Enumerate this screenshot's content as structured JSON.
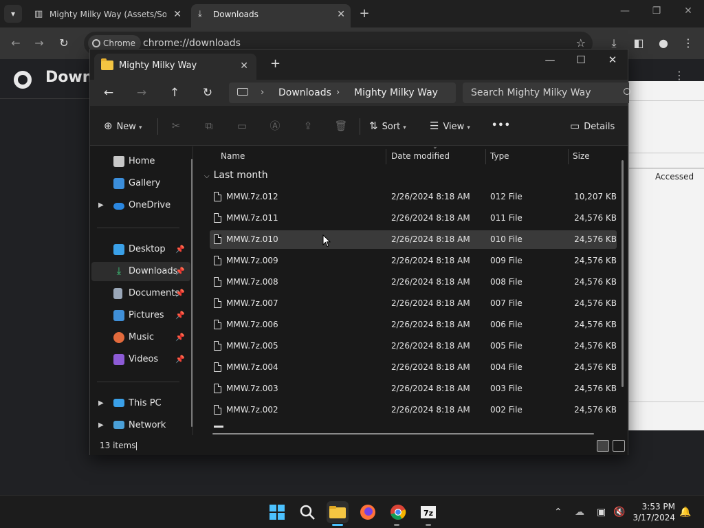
{
  "chrome": {
    "tabs": [
      {
        "title": "Mighty Milky Way (Assets/Soun",
        "icon": "archive-icon"
      },
      {
        "title": "Downloads",
        "icon": "download-icon"
      }
    ],
    "omnibox_chip": "Chrome",
    "url": "chrome://downloads",
    "page_title": "Downlo"
  },
  "sevenzip": {
    "column": "Accessed"
  },
  "explorer": {
    "tab_title": "Mighty Milky Way",
    "breadcrumbs": [
      "Downloads",
      "Mighty Milky Way"
    ],
    "search_placeholder": "Search Mighty Milky Way",
    "toolbar": {
      "new": "New",
      "sort": "Sort",
      "view": "View",
      "more": "•••",
      "details": "Details"
    },
    "sidebar": {
      "home": "Home",
      "gallery": "Gallery",
      "onedrive": "OneDrive",
      "desktop": "Desktop",
      "downloads": "Downloads",
      "documents": "Documents",
      "pictures": "Pictures",
      "music": "Music",
      "videos": "Videos",
      "thispc": "This PC",
      "network": "Network"
    },
    "columns": {
      "name": "Name",
      "date": "Date modified",
      "type": "Type",
      "size": "Size"
    },
    "group": "Last month",
    "files": [
      {
        "name": "MMW.7z.012",
        "date": "2/26/2024 8:18 AM",
        "type": "012 File",
        "size": "10,207 KB"
      },
      {
        "name": "MMW.7z.011",
        "date": "2/26/2024 8:18 AM",
        "type": "011 File",
        "size": "24,576 KB"
      },
      {
        "name": "MMW.7z.010",
        "date": "2/26/2024 8:18 AM",
        "type": "010 File",
        "size": "24,576 KB"
      },
      {
        "name": "MMW.7z.009",
        "date": "2/26/2024 8:18 AM",
        "type": "009 File",
        "size": "24,576 KB"
      },
      {
        "name": "MMW.7z.008",
        "date": "2/26/2024 8:18 AM",
        "type": "008 File",
        "size": "24,576 KB"
      },
      {
        "name": "MMW.7z.007",
        "date": "2/26/2024 8:18 AM",
        "type": "007 File",
        "size": "24,576 KB"
      },
      {
        "name": "MMW.7z.006",
        "date": "2/26/2024 8:18 AM",
        "type": "006 File",
        "size": "24,576 KB"
      },
      {
        "name": "MMW.7z.005",
        "date": "2/26/2024 8:18 AM",
        "type": "005 File",
        "size": "24,576 KB"
      },
      {
        "name": "MMW.7z.004",
        "date": "2/26/2024 8:18 AM",
        "type": "004 File",
        "size": "24,576 KB"
      },
      {
        "name": "MMW.7z.003",
        "date": "2/26/2024 8:18 AM",
        "type": "003 File",
        "size": "24,576 KB"
      },
      {
        "name": "MMW.7z.002",
        "date": "2/26/2024 8:18 AM",
        "type": "002 File",
        "size": "24,576 KB"
      }
    ],
    "status": "13 items"
  },
  "taskbar": {
    "time": "3:53 PM",
    "date": "3/17/2024"
  }
}
